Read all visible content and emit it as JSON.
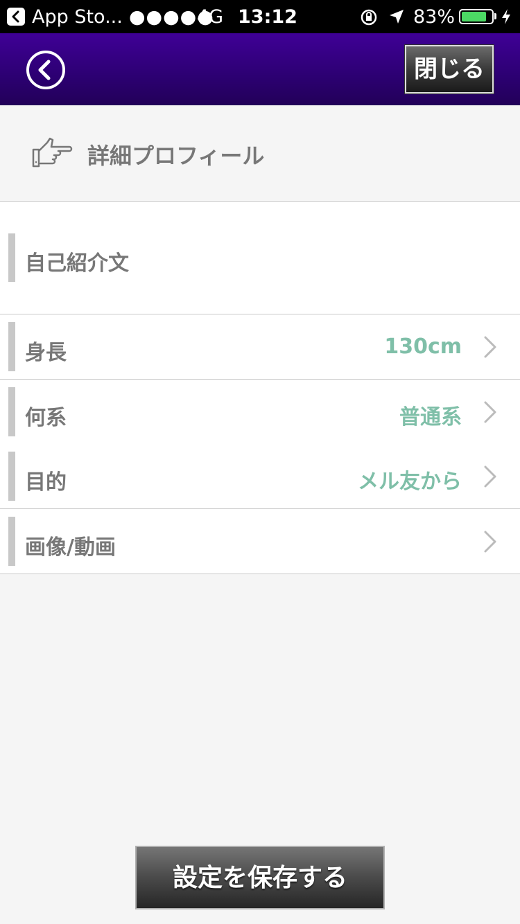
{
  "status_bar": {
    "back_app": "App Sto...",
    "signal_dots": "●●●●●",
    "network": "4G",
    "time": "13:12",
    "battery_percent": "83%",
    "battery_level": 0.83,
    "battery_color": "#4cd964"
  },
  "nav": {
    "back_icon": "chevron-left-circle-icon",
    "close_label": "閉じる",
    "bar_color": "#2c0072"
  },
  "section": {
    "icon": "pointing-hand-icon",
    "title": "詳細プロフィール"
  },
  "intro": {
    "label": "自己紹介文"
  },
  "rows": [
    {
      "label": "身長",
      "value": "130cm"
    },
    {
      "label": "何系",
      "value": "普通系"
    },
    {
      "label": "目的",
      "value": "メル友から"
    },
    {
      "label": "画像/動画",
      "value": ""
    }
  ],
  "accent_value_color": "#7fbfa8",
  "save_button": {
    "label": "設定を保存する"
  }
}
